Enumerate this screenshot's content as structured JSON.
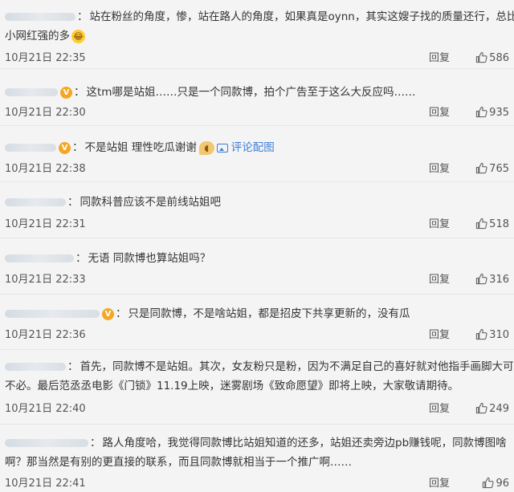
{
  "reply_label": "回复",
  "comments": [
    {
      "name_width": 88,
      "verified": false,
      "text": "站在粉丝的角度，惨，站在路人的角度，如果真是oynn，其实这嫂子找的质量还行，总比",
      "text2": "小网红强的多",
      "emoji": "laugh-emoji",
      "time": "10月21日 22:35",
      "likes": "586"
    },
    {
      "name_width": 66,
      "verified": true,
      "text": "这tm哪是站姐……只是一个同款博，拍个广告至于这么大反应吗……",
      "time": "10月21日 22:30",
      "likes": "935"
    },
    {
      "name_width": 64,
      "verified": true,
      "text": "不是站姐 理性吃瓜谢谢",
      "emoji": "melon-emoji",
      "pic_link": "评论配图",
      "time": "10月21日 22:38",
      "likes": "765"
    },
    {
      "name_width": 76,
      "verified": false,
      "text": "同款科普应该不是前线站姐吧",
      "time": "10月21日 22:31",
      "likes": "518"
    },
    {
      "name_width": 86,
      "verified": false,
      "text": "无语 同款博也算站姐吗？",
      "time": "10月21日 22:33",
      "likes": "316"
    },
    {
      "name_width": 118,
      "verified": true,
      "text": "只是同款博，不是啥站姐，都是招皮下共享更新的，没有瓜",
      "time": "10月21日 22:36",
      "likes": "310"
    },
    {
      "name_width": 76,
      "verified": false,
      "text": "首先，同款博不是站姐。其次，女友粉只是粉，因为不满足自己的喜好就对他指手画脚大可",
      "text2": "不必。最后范丞丞电影《门锁》11.19上映，迷雾剧场《致命愿望》即将上映，大家敬请期待。",
      "time": "10月21日 22:40",
      "likes": "249"
    },
    {
      "name_width": 104,
      "verified": false,
      "text": "路人角度哈，我觉得同款博比站姐知道的还多，站姐还卖旁边pb赚钱呢，同款博图啥",
      "text2": "啊？那当然是有别的更直接的联系，而且同款博就相当于一个推广啊……",
      "time": "10月21日 22:41",
      "likes": "96"
    }
  ]
}
